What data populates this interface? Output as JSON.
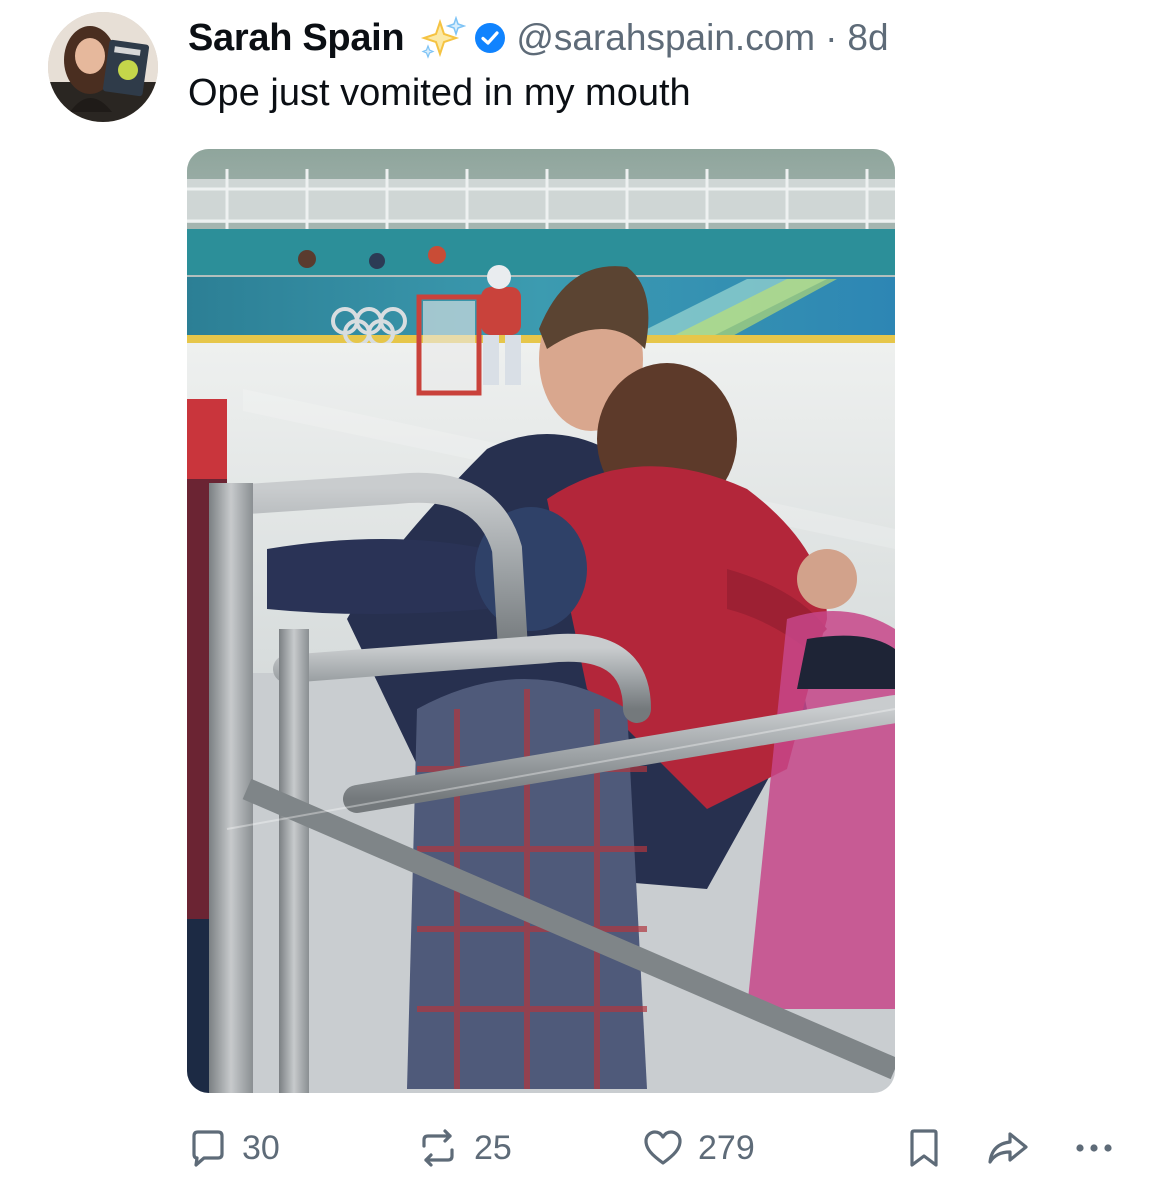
{
  "post": {
    "author": {
      "display_name": "Sarah Spain",
      "handle": "@sarahspain.com",
      "avatar_icon": "profile-photo",
      "badges": [
        "sparkles-icon",
        "verified-check-icon"
      ]
    },
    "separator": "·",
    "timestamp": "8d",
    "text": "Ope just vomited in my mouth",
    "media": {
      "type": "photo",
      "icon": "photo-image"
    }
  },
  "actions": {
    "reply": {
      "icon": "reply-icon",
      "count": "30"
    },
    "repost": {
      "icon": "repost-icon",
      "count": "25"
    },
    "like": {
      "icon": "heart-icon",
      "count": "279"
    },
    "bookmark": {
      "icon": "bookmark-icon"
    },
    "share": {
      "icon": "share-icon"
    },
    "more": {
      "icon": "more-options-icon"
    }
  },
  "colors": {
    "text_primary": "#0b0f14",
    "text_secondary": "#5e6b78",
    "verified_blue": "#1083fe",
    "sparkle_gold": "#f5c342",
    "sparkle_blue": "#7ec3f5"
  }
}
